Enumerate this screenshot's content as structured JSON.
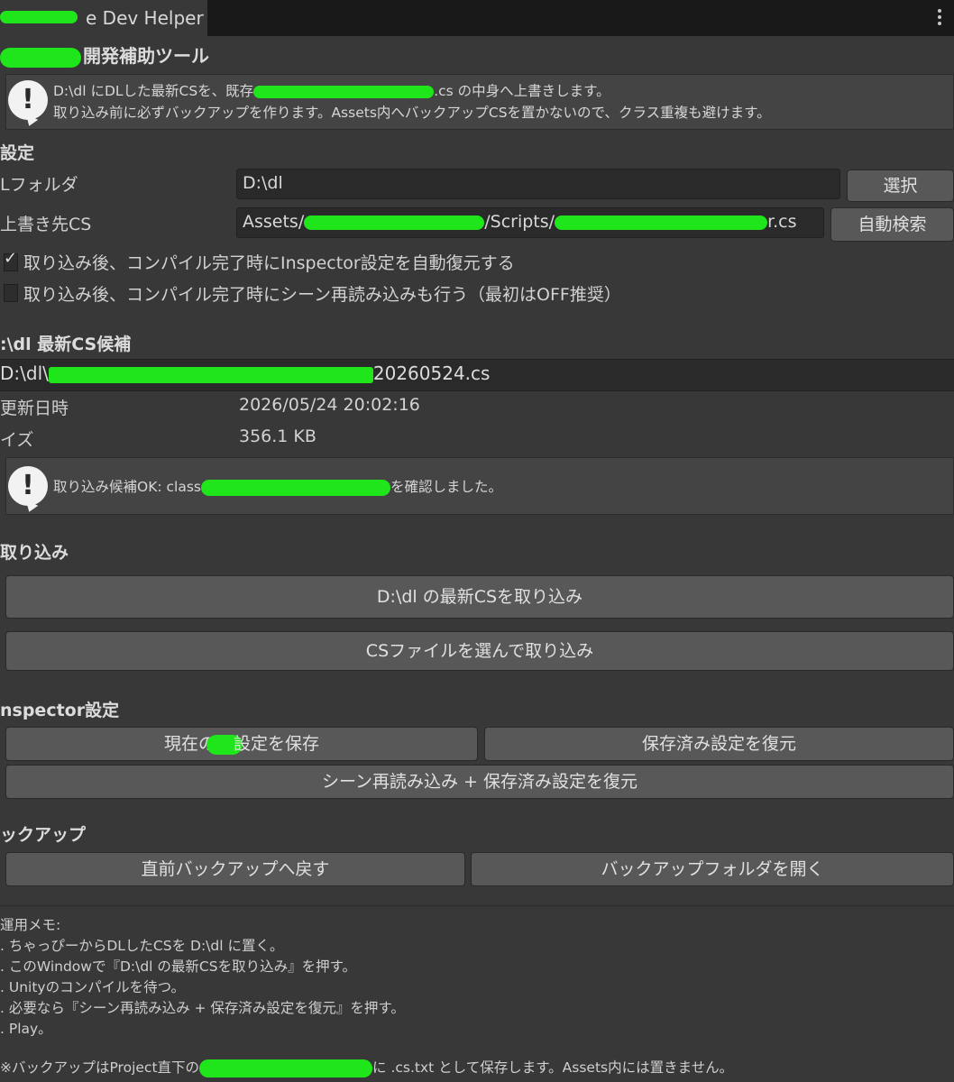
{
  "window": {
    "tab_title": "e Dev Helper",
    "header_title": "開発補助ツール"
  },
  "top_help": {
    "line1_pre": "D:\\dl にDLした最新CSを、既存",
    "line1_post": ".cs の中身へ上書きします。",
    "line2": "取り込み前に必ずバックアップを作ります。Assets内へバックアップCSを置かないので、クラス重複も避けます。"
  },
  "settings": {
    "section": "設定",
    "dl_folder_label": "Lフォルダ",
    "dl_folder_value": "D:\\dl",
    "select_button": "選択",
    "target_label": "上書き先CS",
    "target_value_pre": "Assets/",
    "target_value_mid": "/Scripts/",
    "target_value_post": "r.cs",
    "auto_search_button": "自動検索",
    "check1_label": "取り込み後、コンパイル完了時にInspector設定を自動復元する",
    "check1_checked": true,
    "check2_label": "取り込み後、コンパイル完了時にシーン再読み込みも行う（最初はOFF推奨）",
    "check2_checked": false
  },
  "candidate": {
    "section": ":\\dl 最新CS候補",
    "file_pre": "D:\\dl\\",
    "file_post": "20260524.cs",
    "updated_label": "更新日時",
    "updated_value": "2026/05/24 20:02:16",
    "size_label": "イズ",
    "size_value": "356.1 KB",
    "ok_pre": "取り込み候補OK: class",
    "ok_post": "を確認しました。"
  },
  "import": {
    "section": "取り込み",
    "latest_button": "D:\\dl の最新CSを取り込み",
    "choose_button": "CSファイルを選んで取り込み"
  },
  "inspector": {
    "section": "nspector設定",
    "save_pre": "現在の",
    "save_post": "設定を保存",
    "restore_button": "保存済み設定を復元",
    "reload_button": "シーン再読み込み + 保存済み設定を復元"
  },
  "backup": {
    "section": "ックアップ",
    "revert_button": "直前バックアップへ戻す",
    "open_folder_button": "バックアップフォルダを開く"
  },
  "memo": {
    "title": "運用メモ:",
    "lines": [
      ". ちゃっぴーからDLしたCSを D:\\dl に置く。",
      ". このWindowで『D:\\dl の最新CSを取り込み』を押す。",
      ". Unityのコンパイルを待つ。",
      ". 必要なら『シーン再読み込み + 保存済み設定を復元』を押す。",
      ". Play。"
    ],
    "footer_pre": "※バックアップはProject直下の",
    "footer_post": "に .cs.txt として保存します。Assets内には置きません。"
  },
  "colors": {
    "background": "#383838",
    "field": "#2a2a2a",
    "button": "#585858",
    "redaction": "#1ee61a"
  }
}
